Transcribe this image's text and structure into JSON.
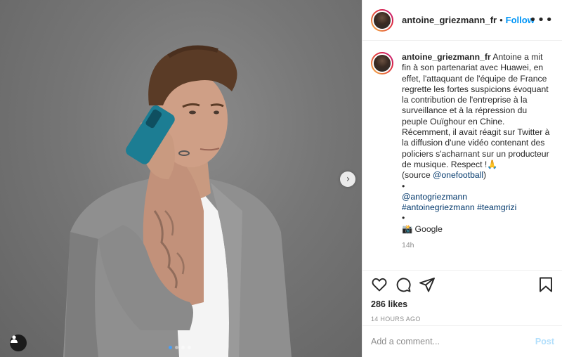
{
  "post": {
    "username": "antoine_griezmann_fr",
    "separator": "•",
    "follow_label": "Follow",
    "more_icon": "•••",
    "next_icon": "›",
    "carousel": {
      "count": 4,
      "active_index": 0
    },
    "caption": {
      "username": "antoine_griezmann_fr",
      "lines": [
        " Antoine a mit fin à son partenariat avec Huawei, en effet, l'attaquant de l'équipe de France regrette les fortes suspicions évoquant la contribution de l'entreprise à la surveillance et à la répression du peuple Ouïghour en Chine. Récemment, il avait réagit sur Twitter à la diffusion d'une vidéo contenant des policiers s'acharnant sur un producteur de musique. Respect !🙏"
      ],
      "source_prefix": "(source ",
      "source_link": "@onefootball",
      "source_suffix": ")",
      "bullet1": "•",
      "mention": "@antogriezmann",
      "hashtag1": "#antoinegriezmann",
      "hashtag2": "#teamgrizi",
      "bullet2": "•",
      "credit": "📸 Google",
      "time": "14h"
    },
    "likes": "286 likes",
    "posted_ago": "14 HOURS AGO",
    "comment_placeholder": "Add a comment...",
    "post_label": "Post"
  },
  "icons": {
    "like": "heart-icon",
    "comment": "comment-icon",
    "share": "share-icon",
    "save": "bookmark-icon",
    "tag": "user-tag-icon"
  },
  "colors": {
    "accent": "#0095f6",
    "link": "#00376b",
    "muted": "#8e8e8e",
    "post_disabled": "#b2dffc",
    "carousel_active": "#4a9ff5"
  }
}
